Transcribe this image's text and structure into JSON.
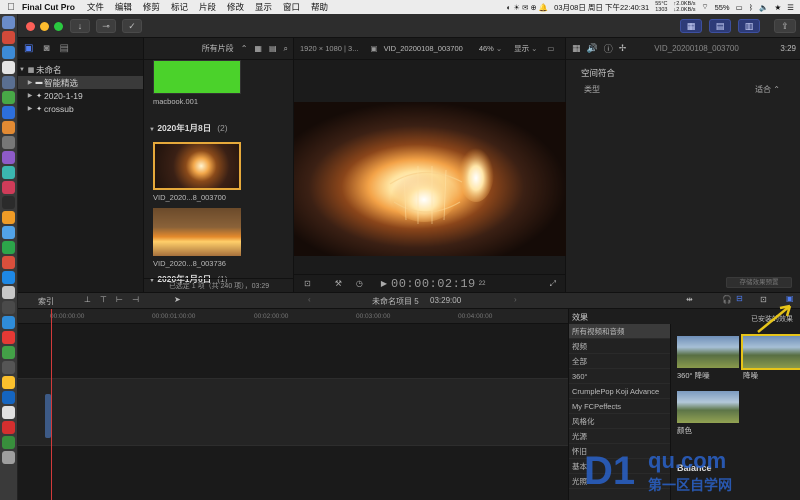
{
  "menubar": {
    "app_name": "Final Cut Pro",
    "menus": [
      "文件",
      "编辑",
      "修剪",
      "标记",
      "片段",
      "修改",
      "显示",
      "窗口",
      "帮助"
    ],
    "datetime": "03月08日 周日 下午22:40:31",
    "cpu_temp": "55°C",
    "cpu_freq": "1303",
    "net_up": "↑2.0KB/s",
    "net_down": "↓2.0KB/s",
    "battery": "55%"
  },
  "library": {
    "items": [
      {
        "label": "未命名"
      },
      {
        "label": "智能精选"
      },
      {
        "label": "2020-1-19"
      },
      {
        "label": "crossub"
      }
    ]
  },
  "browser": {
    "filter": "所有片段",
    "top_clip_caption": "macbook.001",
    "groups": [
      {
        "date": "2020年1月8日",
        "count": "(2)"
      },
      {
        "date": "2020年1月6日",
        "count": "(1)"
      }
    ],
    "clips": [
      {
        "caption": "VID_2020...8_003700"
      },
      {
        "caption": "VID_2020...8_003736"
      }
    ],
    "status": "已选定 1 项（共 240 项），03:29"
  },
  "viewer": {
    "format": "1920 × 1080 | 3...",
    "clip_name": "VID_20200108_003700",
    "zoom": "46%",
    "display_menu": "显示",
    "timecode": "00:00:02:19",
    "timecode_frames": "22"
  },
  "inspector": {
    "clip_name": "VID_20200108_003700",
    "clip_time": "3:29",
    "section": "空间符合",
    "row_label": "类型",
    "row_value": "适合",
    "save_button": "存储效果预置"
  },
  "timeline": {
    "index_label": "索引",
    "project_name": "未命名项目 5",
    "duration": "03:29:00",
    "ruler": [
      "00:00:00:00",
      "00:00:01:00:00",
      "00:02:00:00",
      "00:03:00:00",
      "00:04:00:00"
    ]
  },
  "effects": {
    "title": "效果",
    "installed_label": "已安装的效果",
    "categories": [
      "所有视频和音频",
      "视频",
      "全部",
      "360°",
      "CrumplePop Koji Advance",
      "My FCPeffects",
      "风格化",
      "光源",
      "怀旧",
      "基本",
      "光照"
    ],
    "selected_index": 0,
    "items": [
      {
        "label": "360° 降噪"
      },
      {
        "label": "降噪"
      },
      {
        "label": "颜色"
      },
      {
        "label": "Balance"
      }
    ]
  },
  "watermark": {
    "brand": "D1",
    "site": "qu.com",
    "slogan": "第一区自学网"
  },
  "colors": {
    "accent_blue": "#4f7ef5",
    "playhead_red": "#d23b3b",
    "arrow_yellow": "#e6c419",
    "watermark_blue": "#2a62c9"
  }
}
